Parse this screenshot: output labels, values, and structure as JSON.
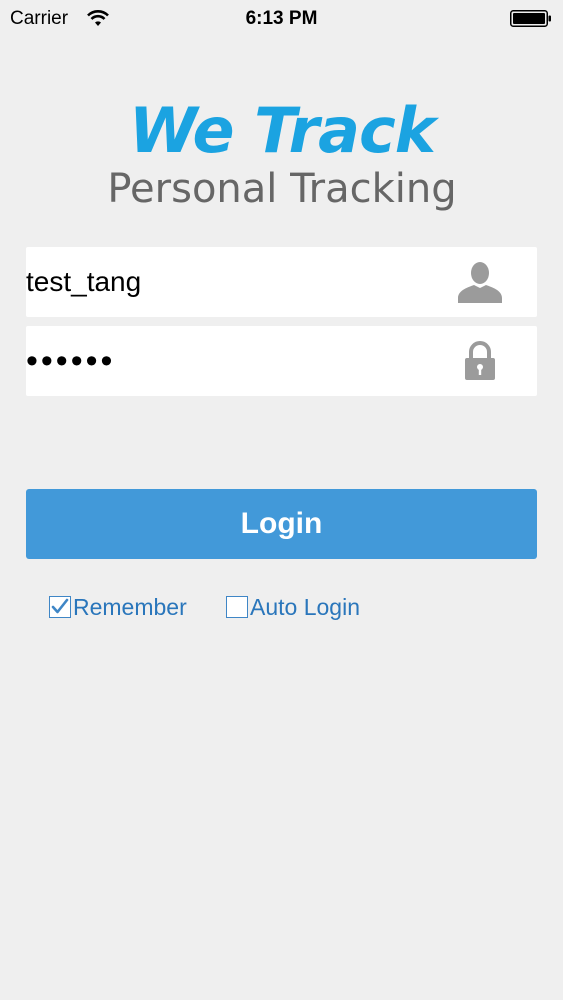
{
  "status_bar": {
    "carrier": "Carrier",
    "time": "6:13 PM",
    "icons": [
      "wifi-icon",
      "battery-icon"
    ]
  },
  "logo": {
    "title": "We Track",
    "subtitle": "Personal Tracking",
    "title_color": "#1ba3e1",
    "subtitle_color": "#666666"
  },
  "form": {
    "username": {
      "value": "test_tang",
      "icon": "user-icon"
    },
    "password": {
      "value": "••••••",
      "icon": "lock-icon"
    },
    "login_label": "Login",
    "login_color": "#4299d9"
  },
  "options": {
    "remember": {
      "label": "Remember",
      "checked": true
    },
    "auto_login": {
      "label": "Auto Login",
      "checked": false
    }
  }
}
